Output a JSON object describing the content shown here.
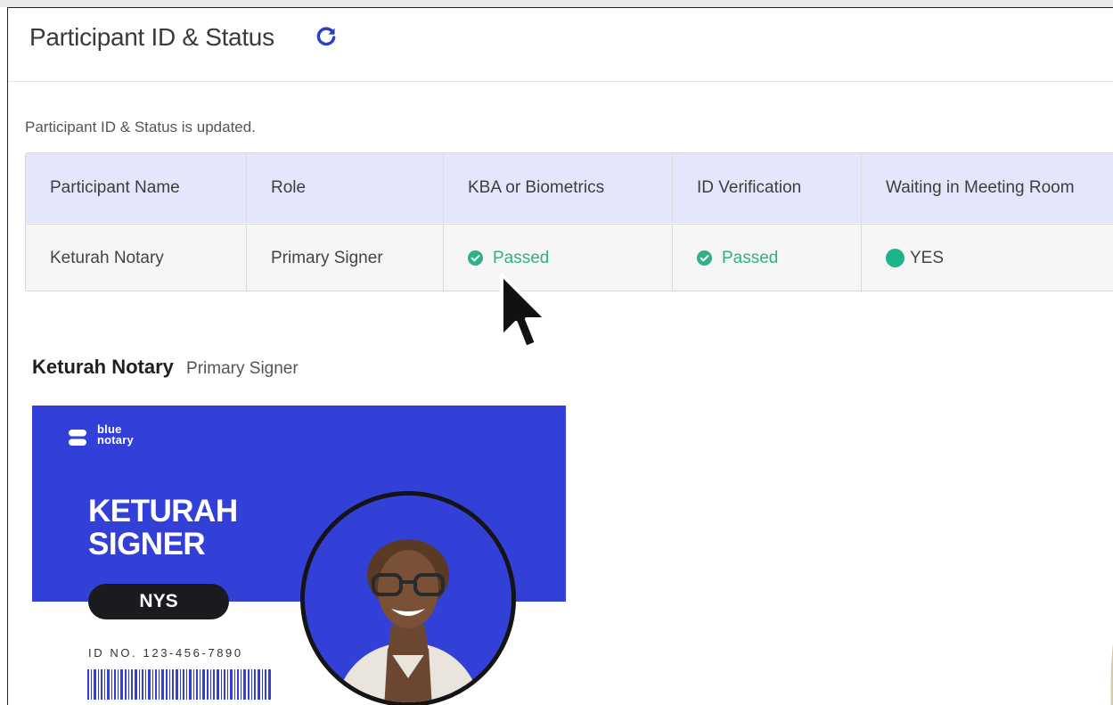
{
  "header": {
    "title": "Participant ID & Status",
    "refresh_icon": "refresh-icon"
  },
  "status_message": "Participant ID & Status is updated.",
  "table": {
    "columns": [
      "Participant Name",
      "Role",
      "KBA or Biometrics",
      "ID Verification",
      "Waiting in Meeting Room"
    ],
    "rows": [
      {
        "participant_name": "Keturah Notary",
        "role": "Primary Signer",
        "kba_or_biometrics": "Passed",
        "id_verification": "Passed",
        "waiting_in_meeting_room": "YES"
      }
    ]
  },
  "participant": {
    "name": "Keturah Notary",
    "role": "Primary Signer"
  },
  "id_card": {
    "logo_line1": "blue",
    "logo_line2": "notary",
    "name_line1": "KETURAH",
    "name_line2": "SIGNER",
    "state": "NYS",
    "id_number": "ID NO. 123-456-7890"
  },
  "colors": {
    "accent_blue": "#3240d8",
    "passed_green": "#2fb08a",
    "header_row": "#e4e6fb",
    "refresh_icon": "#2f3fc4"
  },
  "icons": [
    "refresh-icon",
    "check-circle-icon",
    "status-dot-icon",
    "mouse-pointer-icon",
    "blue-notary-logo-icon"
  ]
}
